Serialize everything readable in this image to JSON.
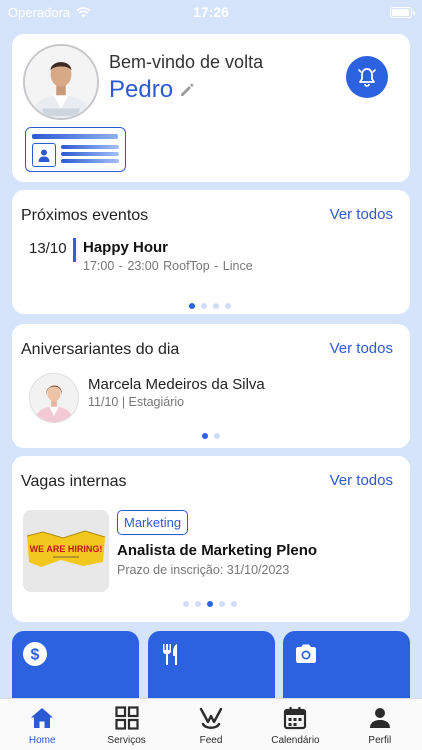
{
  "status_bar": {
    "carrier": "Operadora",
    "time": "17:26"
  },
  "profile": {
    "welcome": "Bem-vindo de volta",
    "name": "Pedro"
  },
  "events": {
    "title": "Próximos eventos",
    "see_all": "Ver todos",
    "items": [
      {
        "date": "13/10",
        "title": "Happy Hour",
        "detail": "17:00 - 23:00  RoofTop - Lince"
      }
    ],
    "page_count": 4,
    "active_page": 0
  },
  "birthdays": {
    "title": "Aniversariantes do dia",
    "see_all": "Ver todos",
    "items": [
      {
        "name": "Marcela Medeiros da Silva",
        "detail": "11/10 | Estagiário"
      }
    ],
    "page_count": 2,
    "active_page": 0
  },
  "jobs": {
    "title": "Vagas internas",
    "see_all": "Ver todos",
    "items": [
      {
        "tag": "Marketing",
        "title": "Analista de Marketing Pleno",
        "deadline": "Prazo de inscrição: 31/10/2023",
        "image_text": "WE ARE HIRING!"
      }
    ],
    "page_count": 5,
    "active_page": 2
  },
  "quick_actions": [
    {
      "icon": "dollar-icon"
    },
    {
      "icon": "cutlery-icon"
    },
    {
      "icon": "camera-icon"
    }
  ],
  "tab_bar": {
    "items": [
      {
        "label": "Home",
        "icon": "home-icon",
        "active": true
      },
      {
        "label": "Serviços",
        "icon": "grid-icon",
        "active": false
      },
      {
        "label": "Feed",
        "icon": "feed-icon",
        "active": false
      },
      {
        "label": "Calendário",
        "icon": "calendar-icon",
        "active": false
      },
      {
        "label": "Perfil",
        "icon": "person-icon",
        "active": false
      }
    ]
  },
  "colors": {
    "accent": "#2c62e0",
    "link": "#2c5ad3",
    "background": "#d6e4fb"
  }
}
